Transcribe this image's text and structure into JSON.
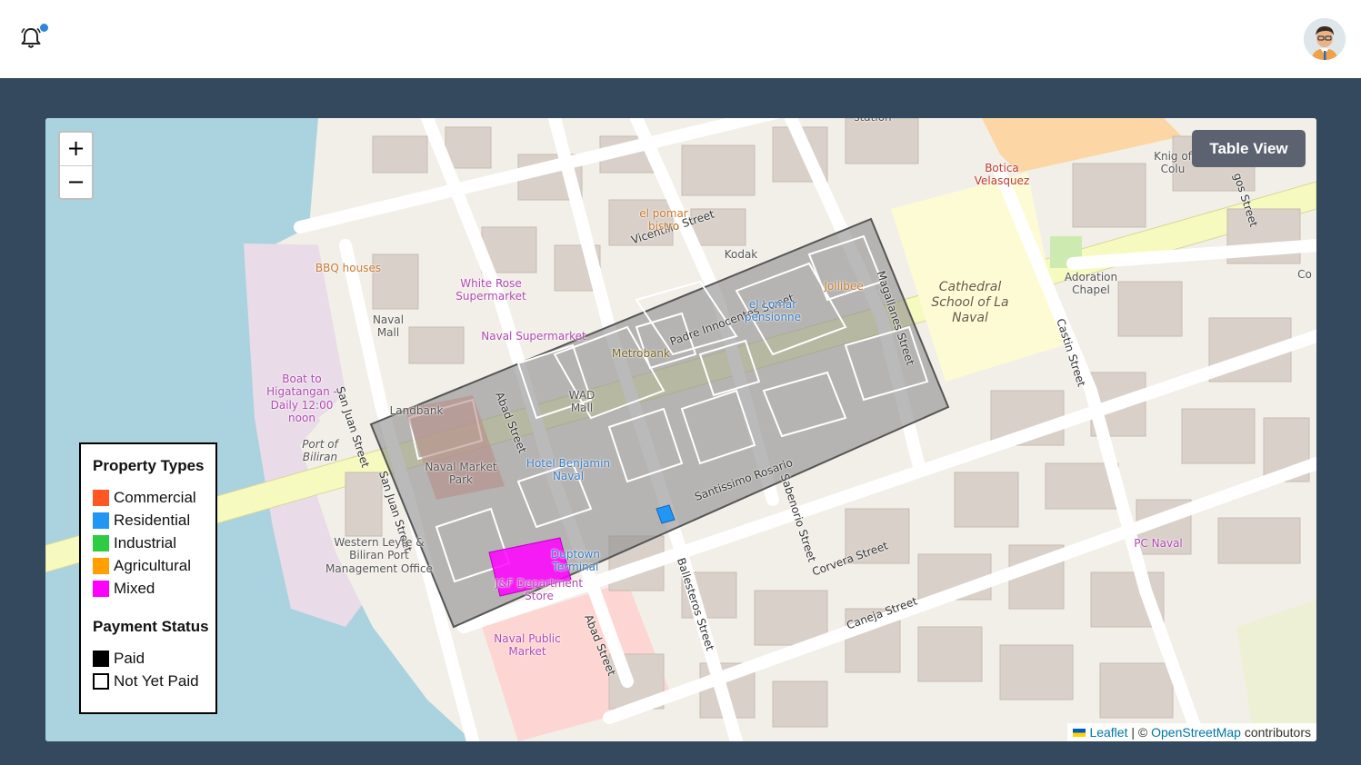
{
  "header": {
    "notification_icon": "bell-icon",
    "has_unread": true,
    "avatar_icon": "user-avatar"
  },
  "map": {
    "zoom_in_label": "+",
    "zoom_out_label": "−",
    "table_view_label": "Table View",
    "attribution": {
      "leaflet": "Leaflet",
      "separator": " | © ",
      "osm": "OpenStreetMap",
      "suffix": " contributors"
    },
    "streets": [
      "Vicentillo Street",
      "Padre Innocentes Street",
      "San Juan Street",
      "San Juan Street",
      "Abad Street",
      "Abad Street",
      "Magallanes Street",
      "Santissimo Rosario",
      "Sabenorio Street",
      "Corvera Street",
      "Ballesteros Street",
      "Castin Street",
      "Caneja Street",
      "gos Street"
    ],
    "places": [
      "BBQ houses",
      "White Rose Supermarket",
      "el pomar bistro",
      "Kodak",
      "Naval Mall",
      "Naval Supermarket",
      "Metrobank",
      "el Lomar pensionne",
      "Jollibee",
      "Botica Velasquez",
      "Knig of Colu",
      "Adoration Chapel",
      "Cathedral School of La Naval",
      "Boat to Higatangan - Daily 12:00 noon",
      "Landbank",
      "WAD Mall",
      "Port of Biliran",
      "Naval Market Park",
      "Hotel Benjamin Naval",
      "Western Leyte & Biliran Port Management Office",
      "J&F Department Store",
      "Duptown Terminal",
      "Naval Public Market",
      "PC Naval",
      "station",
      "Co"
    ]
  },
  "legend": {
    "property_title": "Property Types",
    "property_types": [
      {
        "label": "Commercial",
        "color": "#ff5722"
      },
      {
        "label": "Residential",
        "color": "#2196f3"
      },
      {
        "label": "Industrial",
        "color": "#2ecc40"
      },
      {
        "label": "Agricultural",
        "color": "#ff9f00"
      },
      {
        "label": "Mixed",
        "color": "#ff00ff"
      }
    ],
    "payment_title": "Payment Status",
    "payment_status": [
      {
        "label": "Paid",
        "color": "#000000"
      },
      {
        "label": "Not Yet Paid",
        "color": "#ffffff"
      }
    ]
  }
}
